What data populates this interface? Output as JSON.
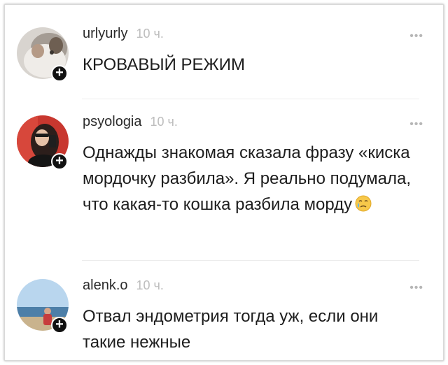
{
  "comments": [
    {
      "username": "urlyurly",
      "time": "10 ч.",
      "text": "КРОВАВЫЙ РЕЖИМ",
      "more_icon": "more-dots-icon",
      "follow_icon": "plus-icon"
    },
    {
      "username": "psyologia",
      "time": "10 ч.",
      "text": "Однажды знакомая сказала фразу «киска мордочку разбила». Я реально подумала, что какая-то кошка разбила морду",
      "emoji": "crying-face-emoji",
      "more_icon": "more-dots-icon",
      "follow_icon": "plus-icon"
    },
    {
      "username": "alenk.o",
      "time": "10 ч.",
      "text": "Отвал эндометрия тогда уж, если они такие нежные",
      "more_icon": "more-dots-icon",
      "follow_icon": "plus-icon"
    }
  ],
  "colors": {
    "text": "#1d1d1d",
    "username": "#2b2b2b",
    "timestamp": "#bdbdbd",
    "divider": "#ececec"
  }
}
